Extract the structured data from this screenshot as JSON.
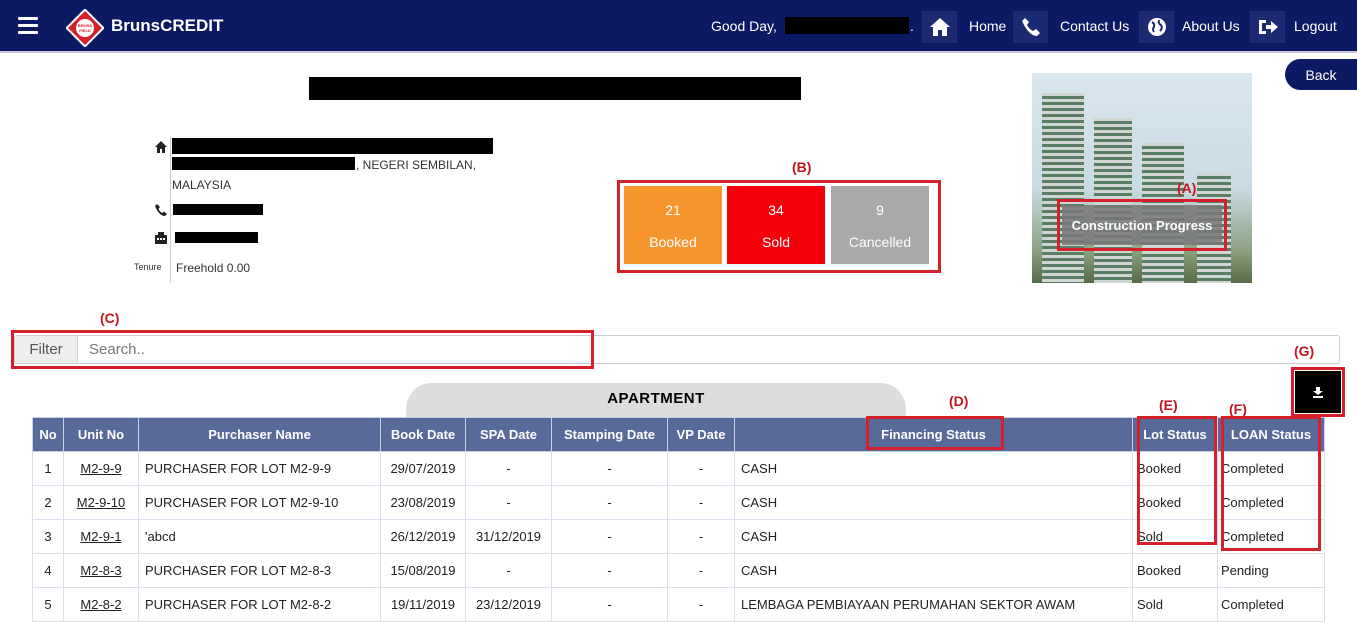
{
  "header": {
    "brand": "BrunsCREDIT",
    "logo_text": "BRUNSFIELD",
    "greeting": "Good Day, ",
    "greeting_suffix": ".",
    "nav": [
      {
        "label": "Home",
        "icon": "home-icon"
      },
      {
        "label": "Contact Us",
        "icon": "phone-icon"
      },
      {
        "label": "About Us",
        "icon": "globe-icon"
      },
      {
        "label": "Logout",
        "icon": "logout-icon"
      }
    ]
  },
  "back_label": "Back",
  "project": {
    "address_line2": ", NEGERI SEMBILAN,",
    "address_line3": "MALAYSIA",
    "tenure_label": "Tenure",
    "tenure_value": "Freehold 0.00"
  },
  "stats": [
    {
      "value": "21",
      "label": "Booked",
      "color": "#f7962f"
    },
    {
      "value": "34",
      "label": "Sold",
      "color": "#f5000a"
    },
    {
      "value": "9",
      "label": "Cancelled",
      "color": "#a9a9a9"
    }
  ],
  "construction_progress_label": "Construction Progress",
  "annotations": {
    "A": "(A)",
    "B": "(B)",
    "C": "(C)",
    "D": "(D)",
    "E": "(E)",
    "F": "(F)",
    "G": "(G)"
  },
  "filter": {
    "label": "Filter",
    "placeholder": "Search.."
  },
  "section_title": "APARTMENT",
  "table": {
    "columns": [
      "No",
      "Unit No",
      "Purchaser Name",
      "Book Date",
      "SPA Date",
      "Stamping Date",
      "VP Date",
      "Financing Status",
      "Lot Status",
      "LOAN Status"
    ],
    "rows": [
      [
        "1",
        "M2-9-9",
        "PURCHASER FOR LOT M2-9-9",
        "29/07/2019",
        "-",
        "-",
        "-",
        "CASH",
        "Booked",
        "Completed"
      ],
      [
        "2",
        "M2-9-10",
        "PURCHASER FOR LOT M2-9-10",
        "23/08/2019",
        "-",
        "-",
        "-",
        "CASH",
        "Booked",
        "Completed"
      ],
      [
        "3",
        "M2-9-1",
        "'abcd",
        "26/12/2019",
        "31/12/2019",
        "-",
        "-",
        "CASH",
        "Sold",
        "Completed"
      ],
      [
        "4",
        "M2-8-3",
        "PURCHASER FOR LOT M2-8-3",
        "15/08/2019",
        "-",
        "-",
        "-",
        "CASH",
        "Booked",
        "Pending"
      ],
      [
        "5",
        "M2-8-2",
        "PURCHASER FOR LOT M2-8-2",
        "19/11/2019",
        "23/12/2019",
        "-",
        "-",
        "LEMBAGA PEMBIAYAAN PERUMAHAN SEKTOR AWAM",
        "Sold",
        "Completed"
      ]
    ]
  }
}
